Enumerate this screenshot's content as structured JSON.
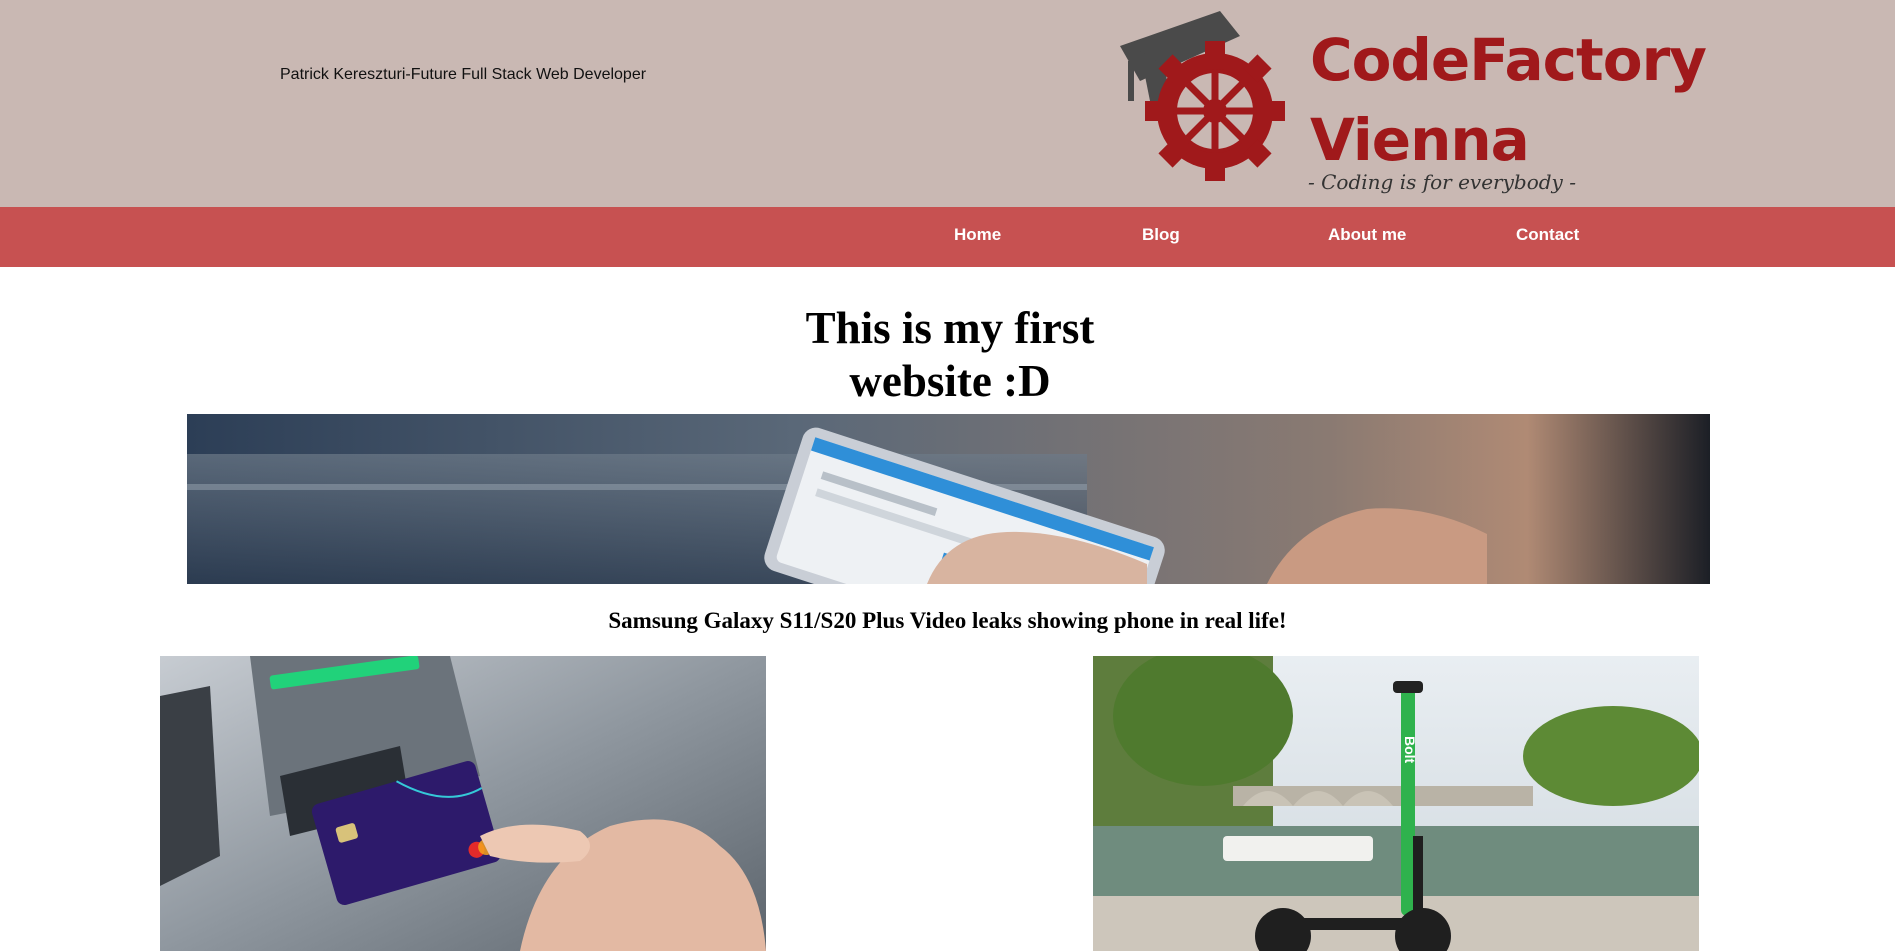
{
  "header": {
    "author_text": "Patrick Kereszturi-Future Full Stack Web Developer",
    "logo": {
      "line1": "CodeFactory",
      "line2": "Vienna",
      "tagline": "- Coding is for everybody -",
      "brand_color": "#a0191b",
      "cap_color": "#4a4a4a"
    },
    "background": "#c9b8b3"
  },
  "nav": {
    "background": "#c75151",
    "items": [
      {
        "label": "Home"
      },
      {
        "label": "Blog"
      },
      {
        "label": "About me"
      },
      {
        "label": "Contact"
      }
    ]
  },
  "main": {
    "title_line1": "This is my first",
    "title_line2": "website :D",
    "banner_caption": "Samsung Galaxy S11/S20 Plus Video leaks showing phone in real life!",
    "banner_icon": "tablet-in-hands-photo",
    "left_image_icon": "card-in-atm-photo",
    "right_image_icon": "bolt-scooter-photo",
    "scooter_label": "Bolt"
  }
}
